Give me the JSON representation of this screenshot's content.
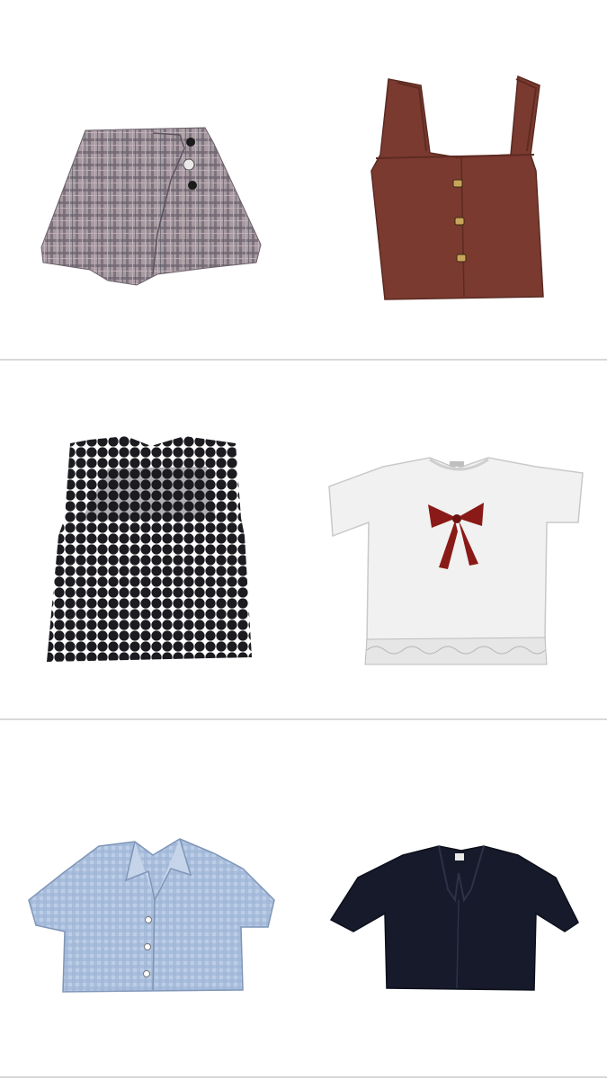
{
  "items": [
    {
      "name": "plaid-skort",
      "color": "#8c8088"
    },
    {
      "name": "rust-knit-vest",
      "color": "#7a3a30"
    },
    {
      "name": "black-circle-lace-top",
      "color": "#1b1b20"
    },
    {
      "name": "white-bow-tshirt",
      "color": "#f2f2f2"
    },
    {
      "name": "blue-gingham-crop-shirt",
      "color": "#a9bfdc"
    },
    {
      "name": "navy-mandarin-blouse",
      "color": "#161a2a"
    }
  ]
}
